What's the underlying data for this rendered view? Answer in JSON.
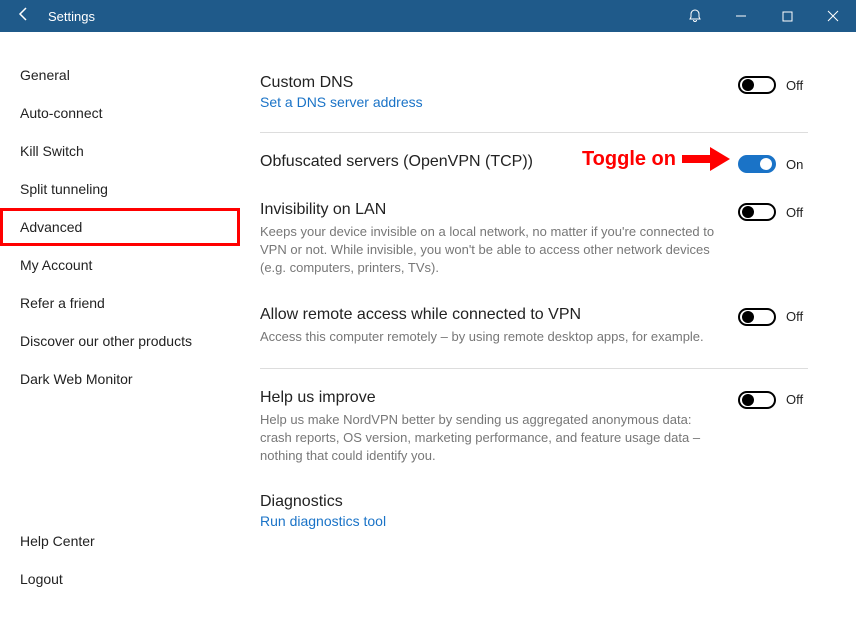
{
  "titlebar": {
    "title": "Settings"
  },
  "sidebar": {
    "items": [
      {
        "label": "General"
      },
      {
        "label": "Auto-connect"
      },
      {
        "label": "Kill Switch"
      },
      {
        "label": "Split tunneling"
      },
      {
        "label": "Advanced",
        "selected": true
      },
      {
        "label": "My Account"
      },
      {
        "label": "Refer a friend"
      },
      {
        "label": "Discover our other products"
      },
      {
        "label": "Dark Web Monitor"
      }
    ],
    "bottom": [
      {
        "label": "Help Center"
      },
      {
        "label": "Logout"
      }
    ]
  },
  "content": {
    "customDns": {
      "title": "Custom DNS",
      "link": "Set a DNS server address",
      "state": "Off"
    },
    "obfuscated": {
      "title": "Obfuscated servers (OpenVPN (TCP))",
      "state": "On"
    },
    "invisibility": {
      "title": "Invisibility on LAN",
      "desc": "Keeps your device invisible on a local network, no matter if you're connected to VPN or not. While invisible, you won't be able to access other network devices (e.g. computers, printers, TVs).",
      "state": "Off"
    },
    "remote": {
      "title": "Allow remote access while connected to VPN",
      "desc": "Access this computer remotely – by using remote desktop apps, for example.",
      "state": "Off"
    },
    "improve": {
      "title": "Help us improve",
      "desc": "Help us make NordVPN better by sending us aggregated anonymous data: crash reports, OS version, marketing performance, and feature usage data – nothing that could identify you.",
      "state": "Off"
    },
    "diagnostics": {
      "title": "Diagnostics",
      "link": "Run diagnostics tool"
    }
  },
  "annotation": {
    "text": "Toggle on"
  }
}
